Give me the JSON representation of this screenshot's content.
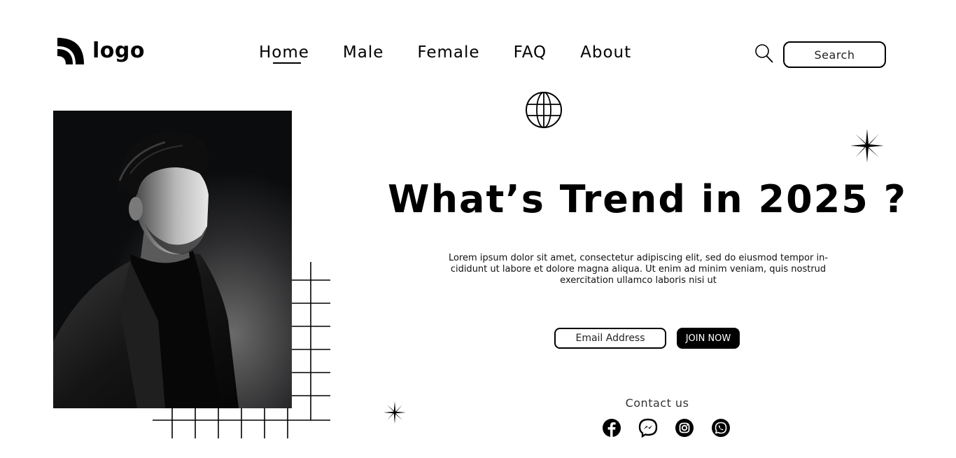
{
  "header": {
    "logo_text": "logo",
    "nav": [
      {
        "label": "Home",
        "active": true
      },
      {
        "label": "Male",
        "active": false
      },
      {
        "label": "Female",
        "active": false
      },
      {
        "label": "FAQ",
        "active": false
      },
      {
        "label": "About",
        "active": false
      }
    ],
    "search_placeholder": "Search"
  },
  "hero": {
    "title": "What’s Trend in 2025 ?",
    "description": "Lorem ipsum dolor sit amet, consectetur adipiscing elit, sed do eiusmod tempor in-cididunt ut labore et dolore magna aliqua. Ut enim ad minim veniam, quis nostrud exercitation ullamco laboris nisi ut",
    "email_placeholder": "Email Address",
    "join_label": "JOIN NOW"
  },
  "contact": {
    "title": "Contact us",
    "icons": [
      "facebook-icon",
      "messenger-icon",
      "instagram-icon",
      "whatsapp-icon"
    ]
  },
  "colors": {
    "text": "#000000",
    "background": "#ffffff",
    "button": "#000000"
  }
}
